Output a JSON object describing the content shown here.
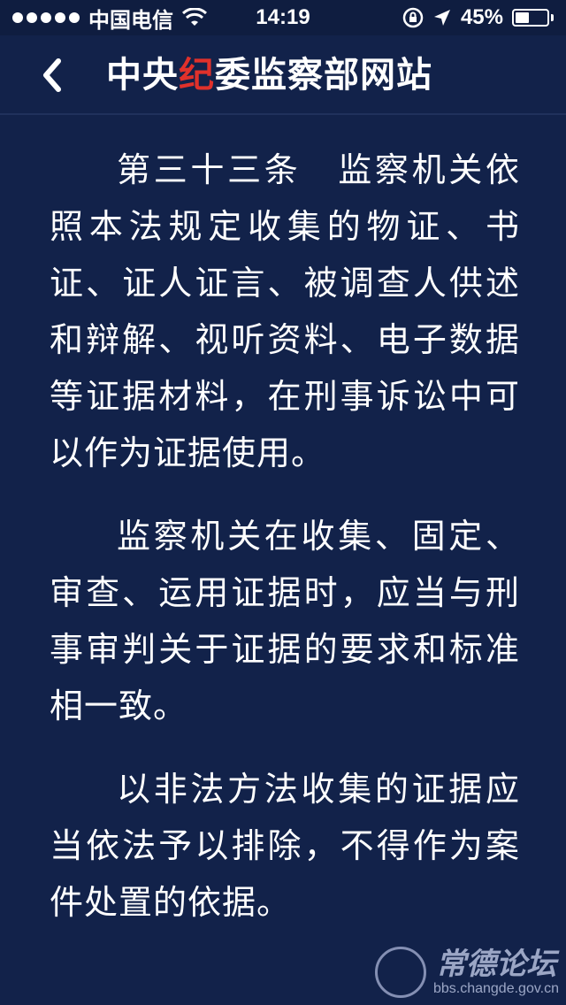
{
  "status_bar": {
    "carrier": "中国电信",
    "time": "14:19",
    "battery_percent_label": "45%",
    "battery_level": 0.45,
    "icons": [
      "signal-dots",
      "wifi-icon",
      "rotation-lock-icon",
      "location-arrow-icon",
      "battery-icon"
    ]
  },
  "nav": {
    "title_part1": "中央",
    "title_accent": "纪",
    "title_part2": "委监察部网站",
    "accent_color": "#e0312b",
    "back_icon": "chevron-left-icon"
  },
  "article": {
    "paragraphs": [
      "第三十三条　监察机关依照本法规定收集的物证、书证、证人证言、被调查人供述和辩解、视听资料、电子数据等证据材料，在刑事诉讼中可以作为证据使用。",
      "监察机关在收集、固定、审查、运用证据时，应当与刑事审判关于证据的要求和标准相一致。",
      "以非法方法收集的证据应当依法予以排除，不得作为案件处置的依据。"
    ]
  },
  "watermark": {
    "name": "常德论坛",
    "url": "bbs.changde.gov.cn"
  },
  "colors": {
    "background": "#12224a",
    "text": "#ffffff"
  }
}
